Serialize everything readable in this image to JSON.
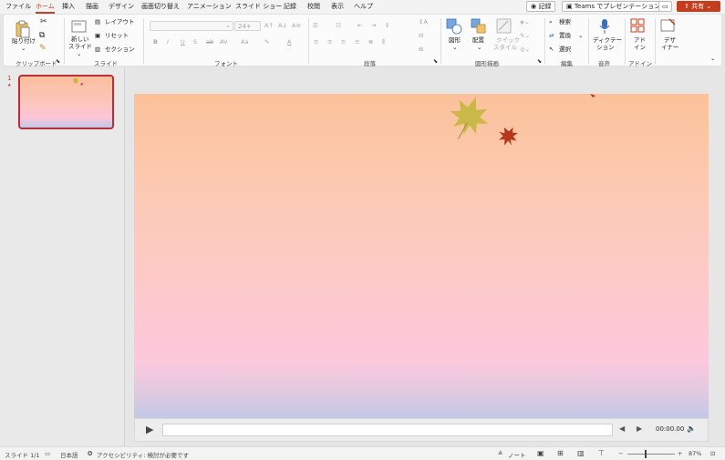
{
  "menu": {
    "tabs": [
      "ファイル",
      "ホーム",
      "挿入",
      "描画",
      "デザイン",
      "画面切り替え",
      "アニメーション",
      "スライド ショー",
      "記録",
      "校閲",
      "表示",
      "ヘルプ"
    ],
    "active_tab": "ホーム",
    "record_label": "記録",
    "teams_label": "Teams でプレゼンテーション",
    "share_label": "共有"
  },
  "ribbon": {
    "clipboard": {
      "paste": "貼り付け",
      "group": "クリップボード"
    },
    "slides": {
      "new_slide_1": "新しい",
      "new_slide_2": "スライド",
      "layout": "レイアウト",
      "reset": "リセット",
      "section": "セクション",
      "group": "スライド"
    },
    "font": {
      "size": "24+",
      "group": "フォント"
    },
    "paragraph": {
      "group": "段落"
    },
    "drawing": {
      "shapes": "図形",
      "arrange": "配置",
      "quick_styles_1": "クイック",
      "quick_styles_2": "スタイル",
      "group": "図形描画"
    },
    "editing": {
      "find": "検索",
      "replace": "置換",
      "select": "選択",
      "group": "編集"
    },
    "voice": {
      "dictate_1": "ディクテー",
      "dictate_2": "ション",
      "group": "音声"
    },
    "addins": {
      "label_1": "アド",
      "label_2": "イン",
      "group": "アドイン"
    },
    "designer": {
      "label_1": "デザ",
      "label_2": "イナー"
    }
  },
  "thumbnails": {
    "slide_number": "1",
    "star": "★"
  },
  "player": {
    "time": "00:00.00"
  },
  "status": {
    "slide": "スライド 1/1",
    "language": "日本語",
    "accessibility": "アクセシビリティ: 検討が必要です",
    "notes": "ノート",
    "zoom": "87%"
  },
  "colors": {
    "accent": "#b7472a",
    "share": "#c43e1c",
    "leaf_yellow": "#c7b844",
    "leaf_red": "#b4391b"
  }
}
